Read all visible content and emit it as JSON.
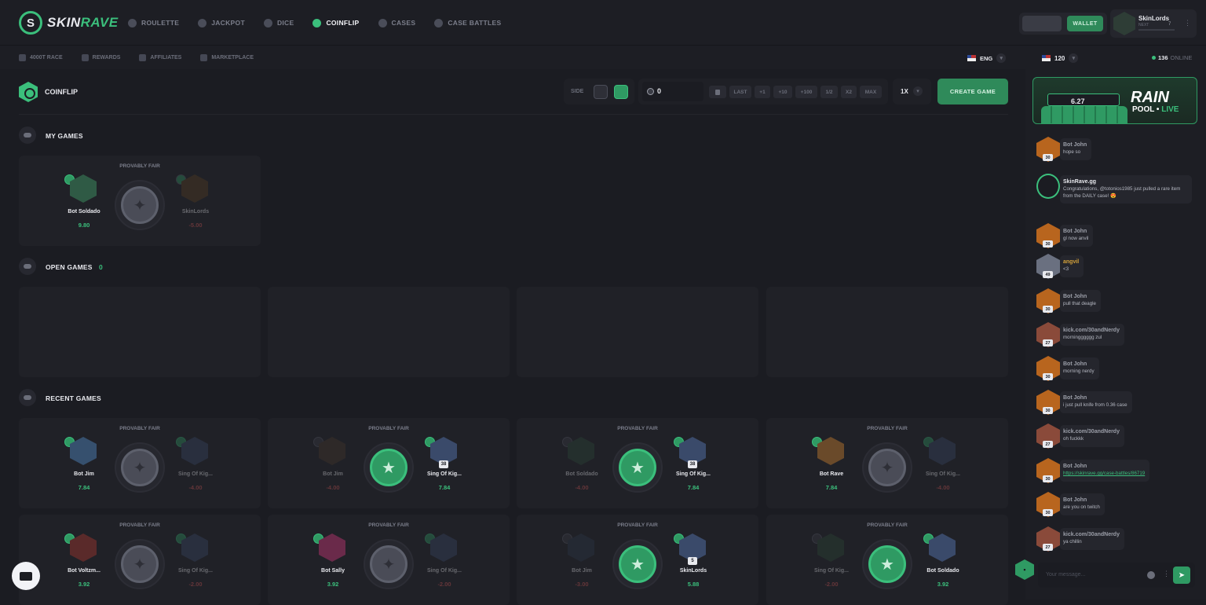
{
  "brand": {
    "logo_letter": "S",
    "name_a": "SKIN",
    "name_b": "RAVE"
  },
  "nav": [
    "ROULETTE",
    "JACKPOT",
    "DICE",
    "COINFLIP",
    "CASES",
    "CASE BATTLES"
  ],
  "subnav": [
    "4000T RACE",
    "REWARDS",
    "AFFILIATES",
    "MARKETPLACE"
  ],
  "header": {
    "wallet": "WALLET",
    "user": "SkinLords",
    "next": "NEXT",
    "level": "7",
    "lang": "ENG"
  },
  "coinflip": {
    "title": "COINFLIP",
    "side_label": "SIDE",
    "bet_value": "0",
    "bet_buttons": [
      "LAST",
      "+1",
      "+10",
      "+100",
      "1/2",
      "X2",
      "MAX"
    ],
    "multiplier": "1X",
    "create": "CREATE GAME"
  },
  "sections": {
    "my_games": "MY GAMES",
    "open_games": "OPEN GAMES",
    "open_count": "0",
    "recent_games": "RECENT GAMES"
  },
  "provably_fair": "PROVABLY FAIR",
  "my_game": {
    "left": {
      "name": "Bot Soldado",
      "amount": "9.80"
    },
    "right": {
      "name": "SkinLords",
      "amount": "-5.00"
    }
  },
  "recent": [
    {
      "l": "Bot Jim",
      "la": "7.84",
      "r": "Sing Of Kig...",
      "ra": "-4.00",
      "winner": "l",
      "rlvl": ""
    },
    {
      "l": "Bot Jim",
      "la": "-4.00",
      "r": "Sing Of Kig...",
      "ra": "7.84",
      "winner": "r",
      "rlvl": "38"
    },
    {
      "l": "Bot Soldado",
      "la": "-4.00",
      "r": "Sing Of Kig...",
      "ra": "7.84",
      "winner": "r",
      "rlvl": "38"
    },
    {
      "l": "Bot Rave",
      "la": "7.84",
      "r": "Sing Of Kig...",
      "ra": "-4.00",
      "winner": "l",
      "rlvl": ""
    },
    {
      "l": "Bot Voltzm...",
      "la": "3.92",
      "r": "Sing Of Kig...",
      "ra": "-2.00",
      "winner": "l",
      "rlvl": ""
    },
    {
      "l": "Bot Sally",
      "la": "3.92",
      "r": "Sing Of Kig...",
      "ra": "-2.00",
      "winner": "l",
      "rlvl": ""
    },
    {
      "l": "Bot Jim",
      "la": "-3.00",
      "r": "SkinLords",
      "ra": "5.88",
      "winner": "r",
      "rlvl": "5"
    },
    {
      "l": "Sing Of Kig...",
      "la": "-2.00",
      "r": "Bot Soldado",
      "ra": "3.92",
      "winner": "r",
      "rlvl": ""
    }
  ],
  "sidebar": {
    "flag_count": "120",
    "online_count": "136",
    "online_label": "ONLINE",
    "rain_amount": "6.27",
    "rain_title": "RAIN",
    "rain_pool": "POOL",
    "rain_live": "LIVE",
    "chat_placeholder": "Your message..."
  },
  "chat": [
    {
      "user": "Bot John",
      "lvl": "30",
      "text": "hope so",
      "style": ""
    },
    {
      "user": "SkinRave.gg",
      "lvl": "",
      "text": "Congratulations, @totonios1985 just pulled a rare item from the DAILY case! 😍",
      "style": "white"
    },
    {
      "user": "Bot John",
      "lvl": "30",
      "text": "gl now anvil",
      "style": ""
    },
    {
      "user": "angvil",
      "lvl": "49",
      "text": "<3",
      "style": "gold"
    },
    {
      "user": "Bot John",
      "lvl": "30",
      "text": "pull that deagle",
      "style": ""
    },
    {
      "user": "kick.com/30andNerdy",
      "lvl": "27",
      "text": "morningggggg zul",
      "style": ""
    },
    {
      "user": "Bot John",
      "lvl": "30",
      "text": "morning nerdy",
      "style": ""
    },
    {
      "user": "Bot John",
      "lvl": "30",
      "text": "i just pull knife from 0.36 case",
      "style": ""
    },
    {
      "user": "kick.com/30andNerdy",
      "lvl": "27",
      "text": "oh fuckkk",
      "style": ""
    },
    {
      "user": "Bot John",
      "lvl": "30",
      "text": "https://skinrave.gg/case-battles/86719",
      "style": "link"
    },
    {
      "user": "Bot John",
      "lvl": "30",
      "text": "are you on twitch",
      "style": ""
    },
    {
      "user": "kick.com/30andNerdy",
      "lvl": "27",
      "text": "ya chillin",
      "style": ""
    }
  ]
}
